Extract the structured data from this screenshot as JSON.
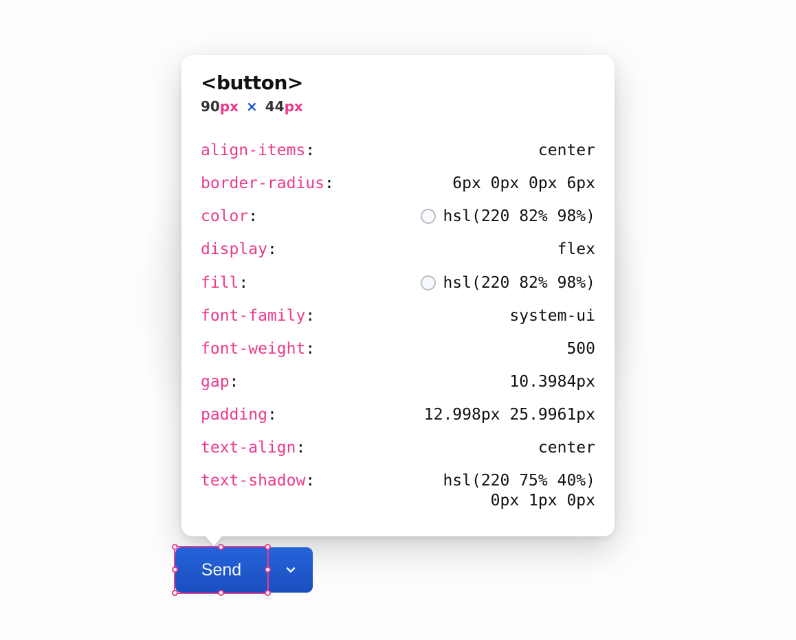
{
  "inspector": {
    "element_tag": "<button>",
    "dimensions": {
      "width": "90",
      "width_unit": "px",
      "height": "44",
      "height_unit": "px"
    },
    "properties": [
      {
        "key": "align-items",
        "value": "center"
      },
      {
        "key": "border-radius",
        "value": "6px 0px 0px 6px"
      },
      {
        "key": "color",
        "value": "hsl(220 82% 98%)",
        "swatch": "#f7faff"
      },
      {
        "key": "display",
        "value": "flex"
      },
      {
        "key": "fill",
        "value": "hsl(220 82% 98%)",
        "swatch": "#f7faff"
      },
      {
        "key": "font-family",
        "value": "system-ui"
      },
      {
        "key": "font-weight",
        "value": "500"
      },
      {
        "key": "gap",
        "value": "10.3984px"
      },
      {
        "key": "padding",
        "value": "12.998px 25.9961px"
      },
      {
        "key": "text-align",
        "value": "center"
      },
      {
        "key": "text-shadow",
        "value_lines": [
          "hsl(220 75% 40%)",
          "0px 1px 0px"
        ]
      }
    ]
  },
  "button": {
    "label": "Send",
    "dropdown_icon": "chevron-down"
  },
  "colors": {
    "accent_pink": "#ec3a8b",
    "accent_blue": "#1a56d6",
    "button_bg": "#1f57c9"
  }
}
